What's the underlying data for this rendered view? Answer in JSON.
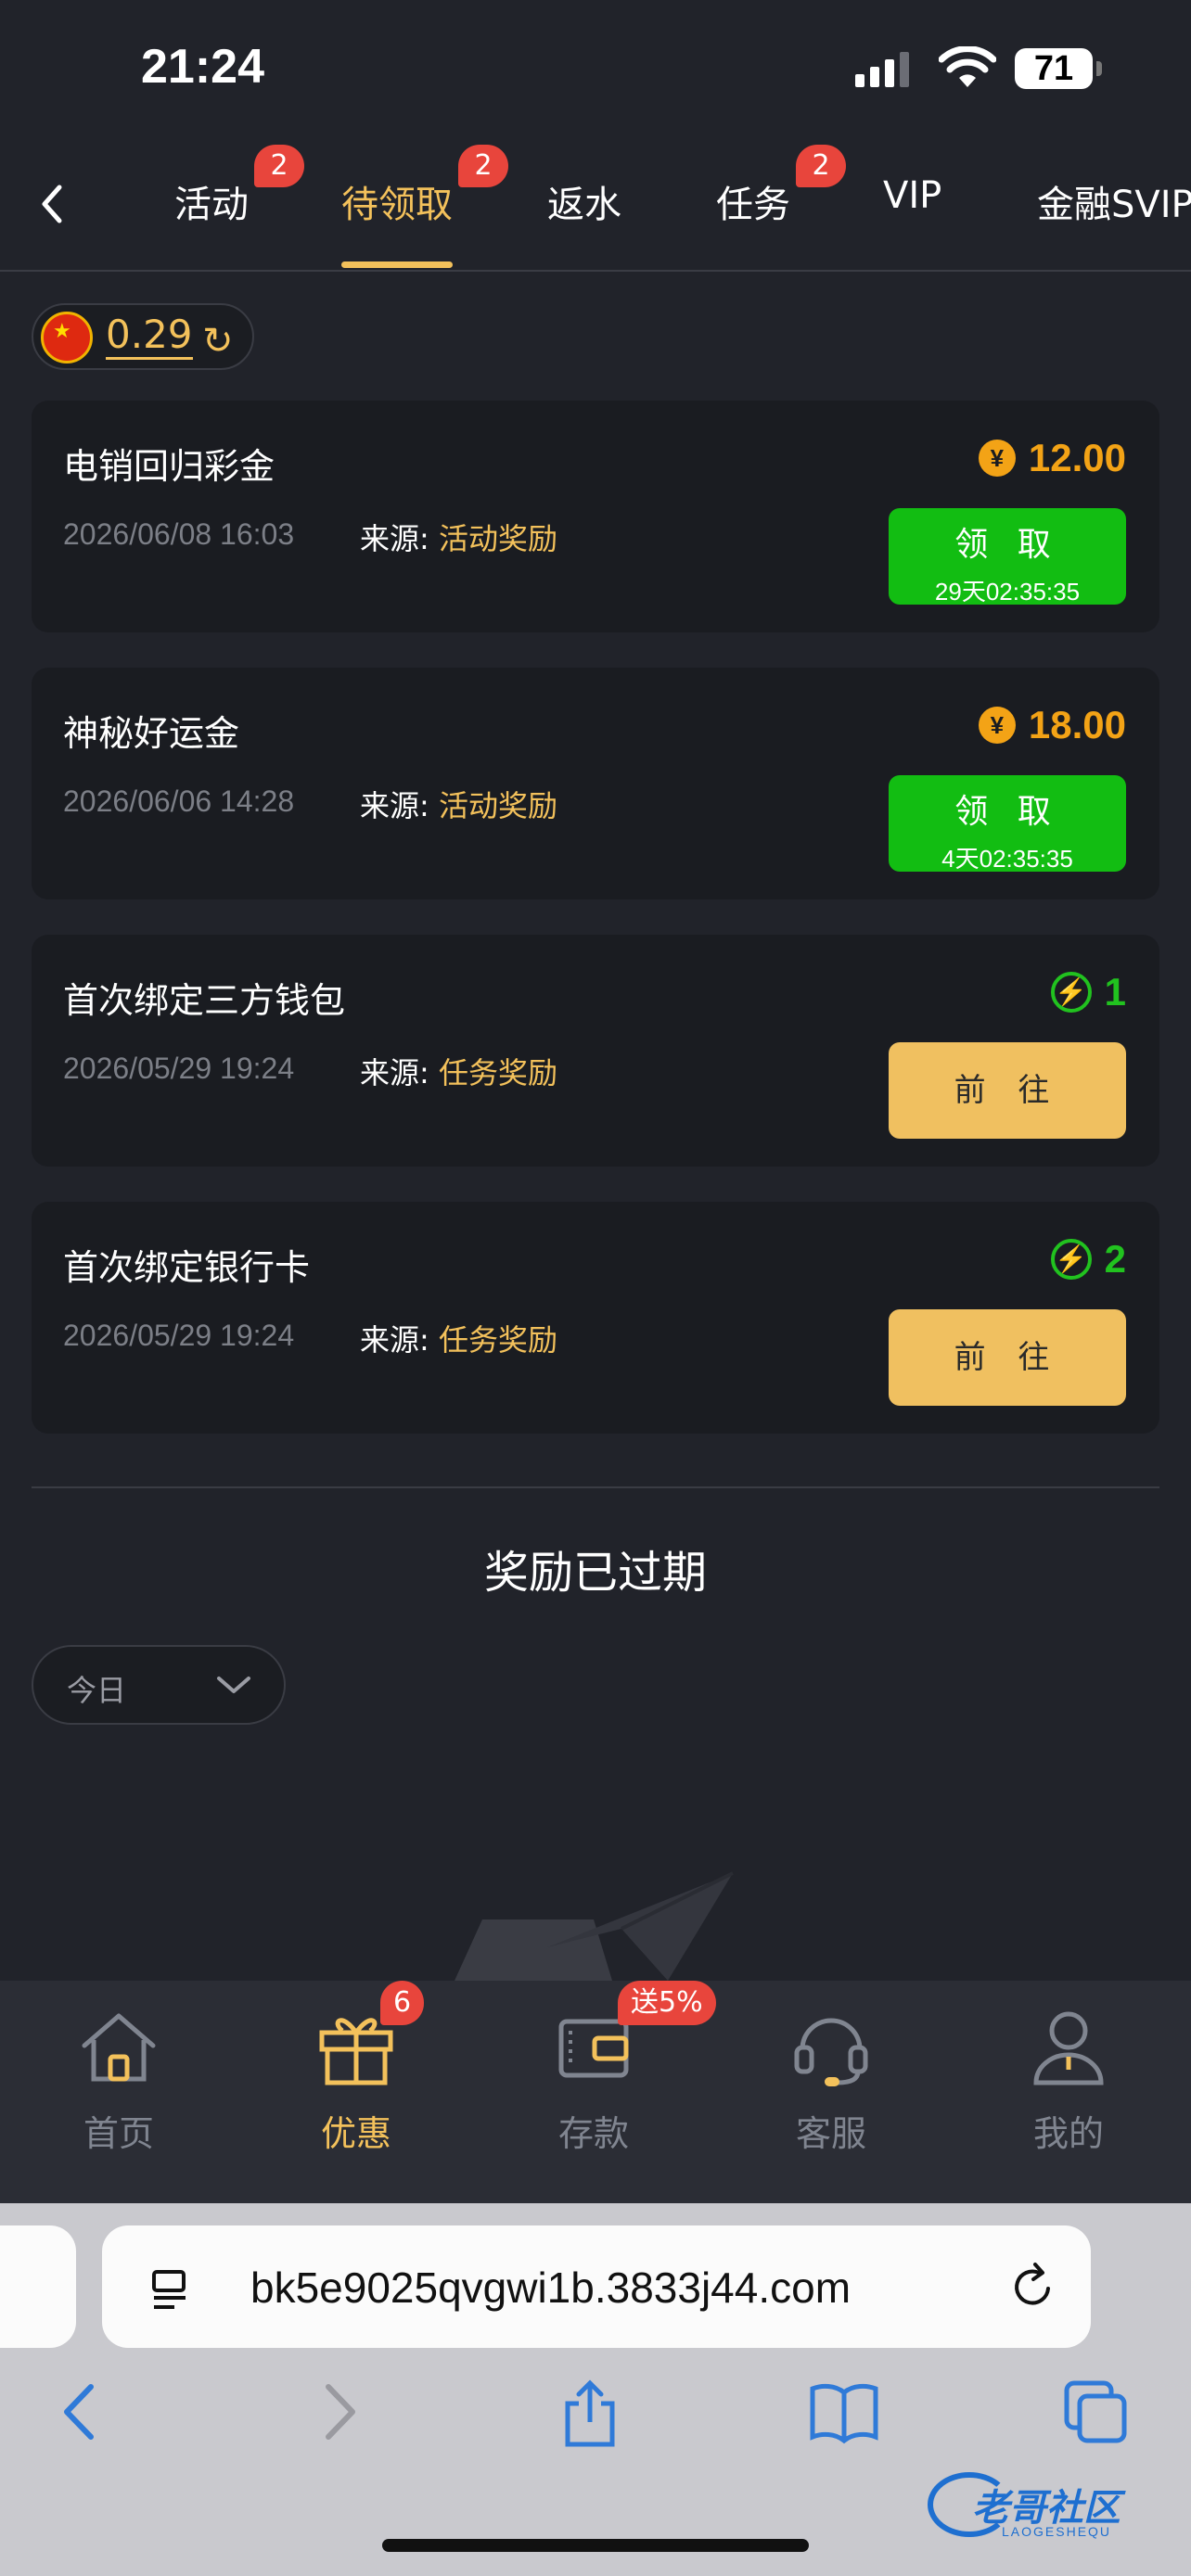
{
  "status_bar": {
    "time": "21:24",
    "battery": "71"
  },
  "tabs": [
    {
      "label": "活动",
      "badge": "2"
    },
    {
      "label": "待领取",
      "badge": "2",
      "active": true
    },
    {
      "label": "返水"
    },
    {
      "label": "任务",
      "badge": "2"
    },
    {
      "label": "VIP"
    },
    {
      "label": "金融SVIP"
    }
  ],
  "balance": {
    "value": "0.29"
  },
  "rewards": [
    {
      "title": "电销回归彩金",
      "date": "2026/06/08 16:03",
      "source_label": "来源:",
      "source": "活动奖励",
      "amount": "12.00",
      "amount_icon": "yen-coin-icon",
      "button": "领 取",
      "countdown": "29天02:35:35"
    },
    {
      "title": "神秘好运金",
      "date": "2026/06/06 14:28",
      "source_label": "来源:",
      "source": "活动奖励",
      "amount": "18.00",
      "amount_icon": "yen-coin-icon",
      "button": "领 取",
      "countdown": "4天02:35:35"
    },
    {
      "title": "首次绑定三方钱包",
      "date": "2026/05/29 19:24",
      "source_label": "来源:",
      "source": "任务奖励",
      "amount": "1",
      "amount_icon": "bolt-icon",
      "button": "前 往"
    },
    {
      "title": "首次绑定银行卡",
      "date": "2026/05/29 19:24",
      "source_label": "来源:",
      "source": "任务奖励",
      "amount": "2",
      "amount_icon": "bolt-icon",
      "button": "前 往"
    }
  ],
  "expired_section": {
    "title": "奖励已过期",
    "filter": "今日"
  },
  "bottom_nav": [
    {
      "label": "首页",
      "icon": "home-icon"
    },
    {
      "label": "优惠",
      "icon": "gift-icon",
      "badge": "6",
      "active": true
    },
    {
      "label": "存款",
      "icon": "wallet-icon",
      "badge": "送5%"
    },
    {
      "label": "客服",
      "icon": "headset-icon"
    },
    {
      "label": "我的",
      "icon": "user-icon"
    }
  ],
  "browser": {
    "url": "bk5e9025qvgwi1b.3833j44.com"
  },
  "watermark": {
    "text": "老哥社区",
    "sub": "LAOGESHEQU"
  },
  "colors": {
    "accent": "#f3c15b",
    "claim_green": "#12bd12",
    "go_yellow": "#f0c060",
    "badge_red": "#e8453c",
    "bg": "#21232a"
  }
}
